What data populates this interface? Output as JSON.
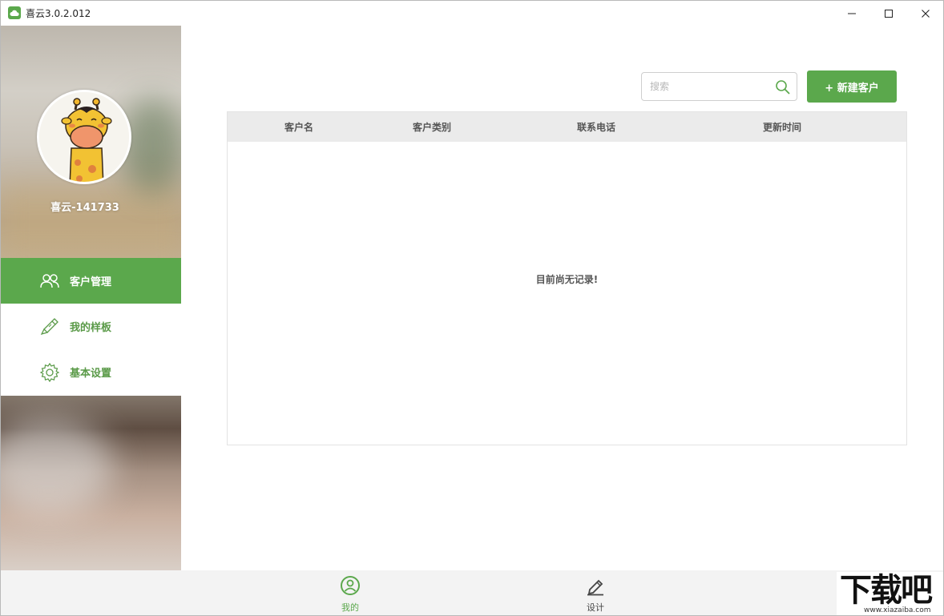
{
  "window": {
    "title": "喜云3.0.2.012"
  },
  "colors": {
    "accent": "#5ba84c",
    "header_bg": "#ebebeb"
  },
  "sidebar": {
    "username": "喜云-141733",
    "items": [
      {
        "label": "客户管理",
        "icon": "users-icon",
        "active": true
      },
      {
        "label": "我的样板",
        "icon": "brush-icon",
        "active": false
      },
      {
        "label": "基本设置",
        "icon": "gear-icon",
        "active": false
      }
    ]
  },
  "toolbar": {
    "search_placeholder": "搜索",
    "new_button_label": "+ 新建客户"
  },
  "table": {
    "columns": [
      "客户名",
      "客户类别",
      "联系电话",
      "更新时间"
    ],
    "empty_text": "目前尚无记录!"
  },
  "bottom_tabs": [
    {
      "label": "我的",
      "icon": "user-circle-icon",
      "active": true
    },
    {
      "label": "设计",
      "icon": "pen-icon",
      "active": false
    }
  ],
  "watermark": {
    "main": "下载吧",
    "sub": "www.xiazaiba.com"
  }
}
